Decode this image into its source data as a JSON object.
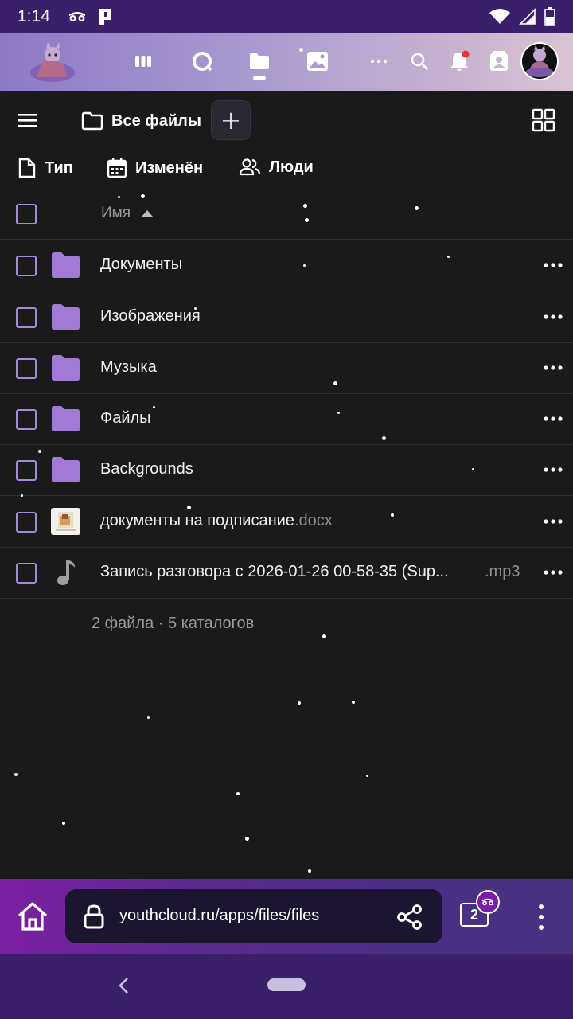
{
  "status_bar": {
    "time": "1:14",
    "icons": [
      "incognito-icon",
      "parking-icon",
      "wifi-icon",
      "signal-icon",
      "battery-icon"
    ]
  },
  "header": {
    "apps": [
      "dashboard-icon",
      "talk-icon",
      "files-icon",
      "photos-icon",
      "more-apps-icon"
    ],
    "active_app": "files-icon",
    "actions": [
      "search-icon",
      "notifications-icon",
      "contacts-icon",
      "avatar"
    ],
    "notification_dot_color": "#e9322d"
  },
  "toolbar": {
    "breadcrumb_label": "Все файлы",
    "add_label": "+"
  },
  "filters": [
    {
      "label": "Тип",
      "icon": "file-type-icon"
    },
    {
      "label": "Изменён",
      "icon": "calendar-icon"
    },
    {
      "label": "Люди",
      "icon": "people-icon"
    }
  ],
  "list": {
    "column_name": "Имя",
    "sort_indicator": "ascending",
    "rows": [
      {
        "name": "Документы",
        "ext": "",
        "type": "folder"
      },
      {
        "name": "Изображения",
        "ext": "",
        "type": "folder"
      },
      {
        "name": "Музыка",
        "ext": "",
        "type": "folder"
      },
      {
        "name": "Файлы",
        "ext": "",
        "type": "folder"
      },
      {
        "name": "Backgrounds",
        "ext": "",
        "type": "folder"
      },
      {
        "name": "документы на подписание",
        "ext": ".docx",
        "type": "docx"
      },
      {
        "name": "Запись разговора с 2026-01-26 00-58-35 (Sup...",
        "ext": ".mp3",
        "type": "audio"
      }
    ],
    "summary": "2 файла · 5 каталогов"
  },
  "browser": {
    "url": "youthcloud.ru/apps/files/files",
    "tab_count": "2"
  },
  "colors": {
    "accent": "#a58ad9",
    "folder": "#a17ad6",
    "status_bar": "#3a1f6b",
    "background": "#1a1a1a"
  }
}
